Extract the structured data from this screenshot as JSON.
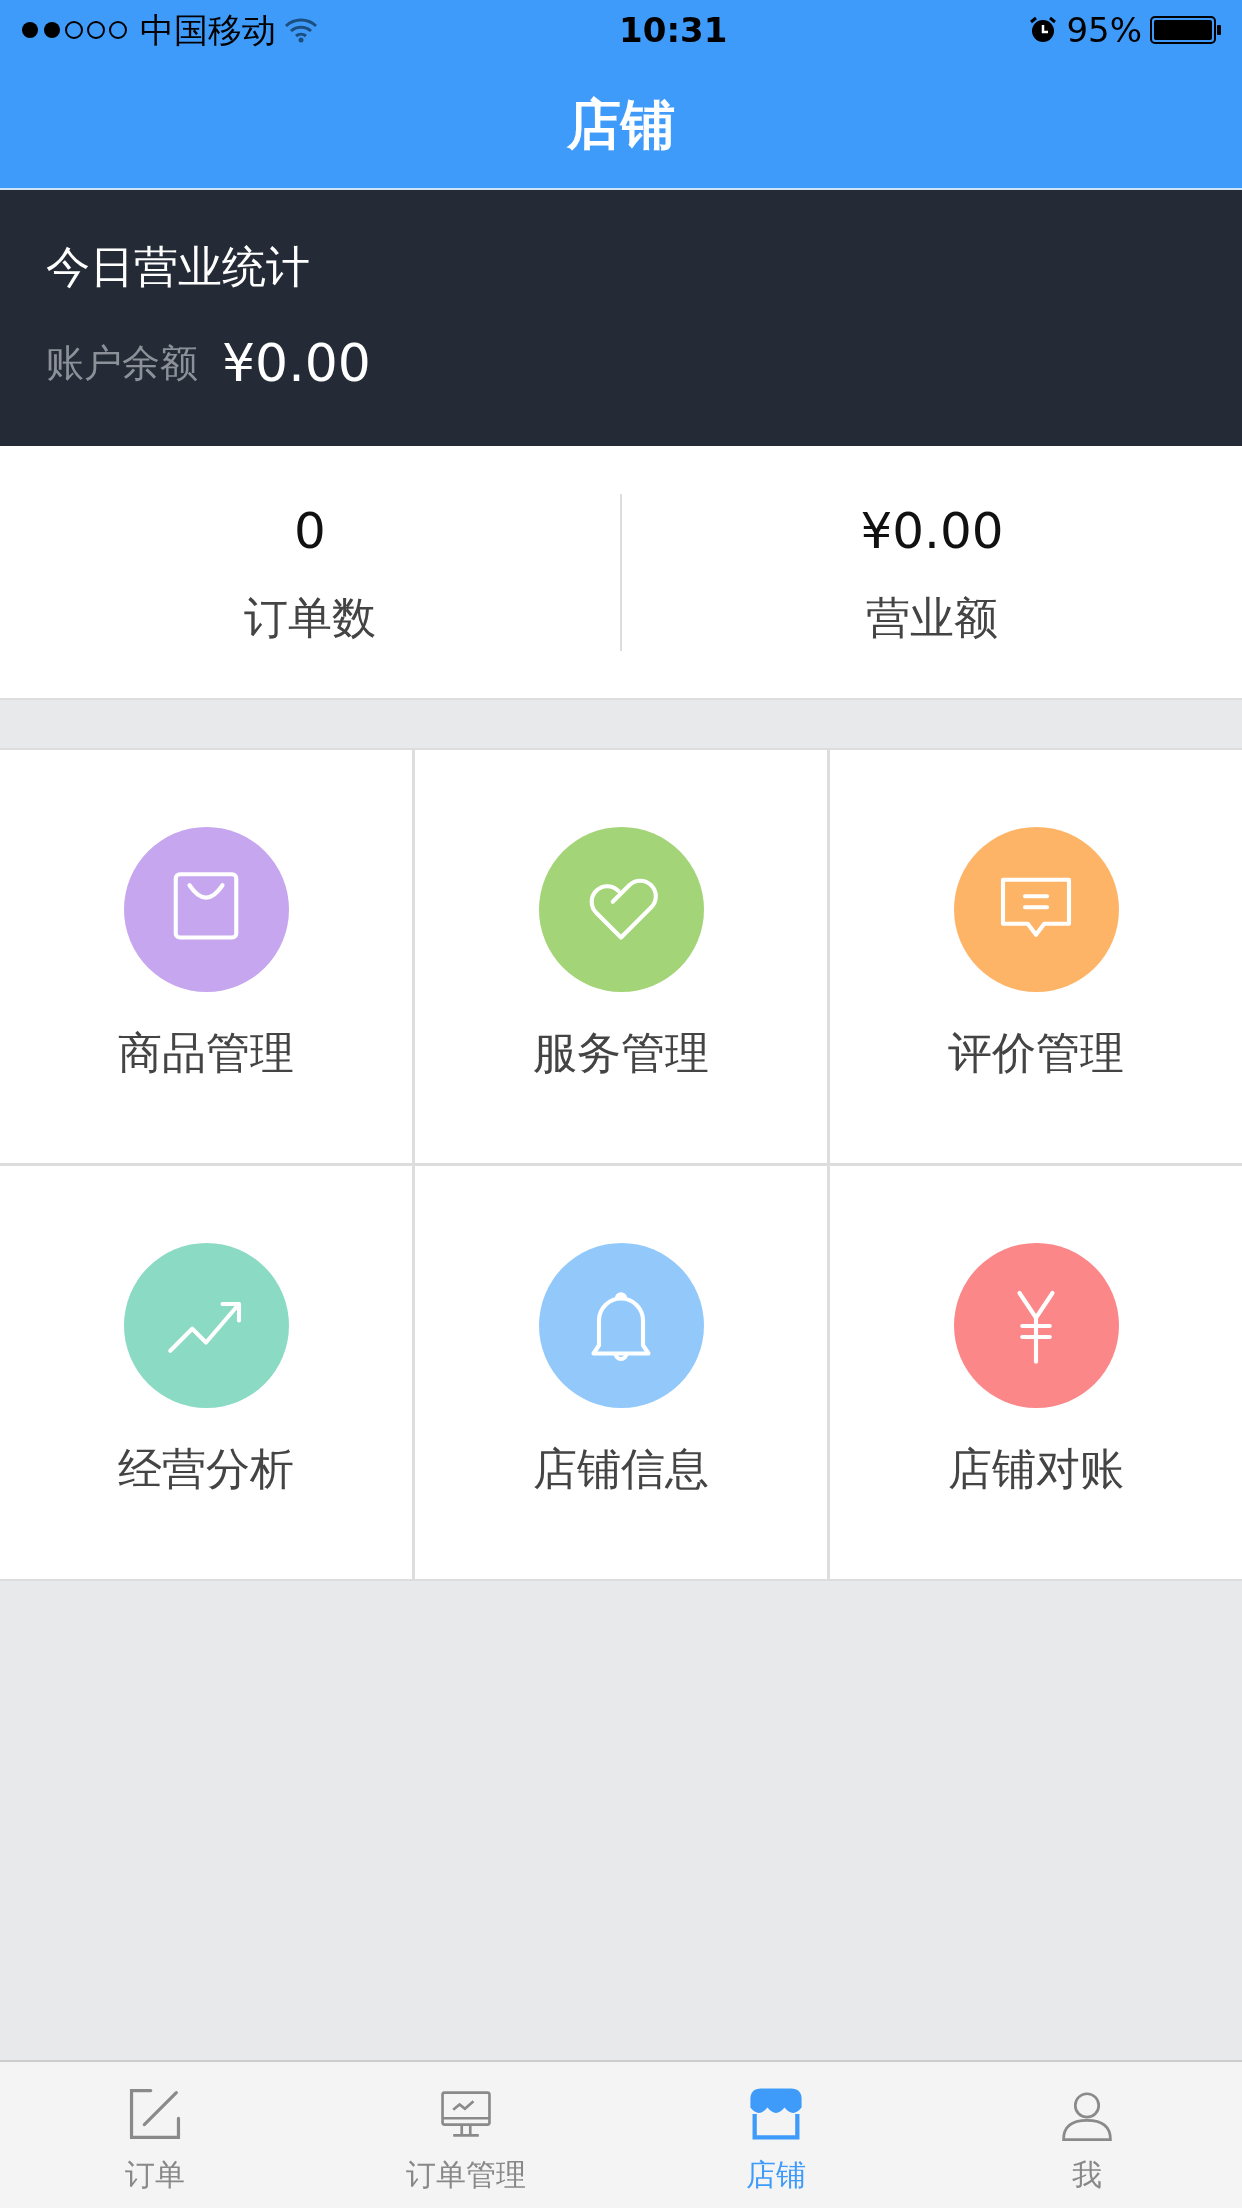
{
  "status_bar": {
    "carrier": "中国移动",
    "time": "10:31",
    "battery": "95%"
  },
  "header": {
    "title": "店铺"
  },
  "today": {
    "title": "今日营业统计",
    "balance_label": "账户余额",
    "balance": "¥0.00"
  },
  "stats": [
    {
      "value": "0",
      "label": "订单数"
    },
    {
      "value": "¥0.00",
      "label": "营业额"
    }
  ],
  "grid": [
    {
      "label": "商品管理",
      "color": "#c5a6ef"
    },
    {
      "label": "服务管理",
      "color": "#a3d477"
    },
    {
      "label": "评价管理",
      "color": "#fdb467"
    },
    {
      "label": "经营分析",
      "color": "#8bdac4"
    },
    {
      "label": "店铺信息",
      "color": "#92c9fa"
    },
    {
      "label": "店铺对账",
      "color": "#fb8788"
    }
  ],
  "tabs": [
    {
      "label": "订单",
      "selected": false
    },
    {
      "label": "订单管理",
      "selected": false
    },
    {
      "label": "店铺",
      "selected": true
    },
    {
      "label": "我",
      "selected": false
    }
  ]
}
